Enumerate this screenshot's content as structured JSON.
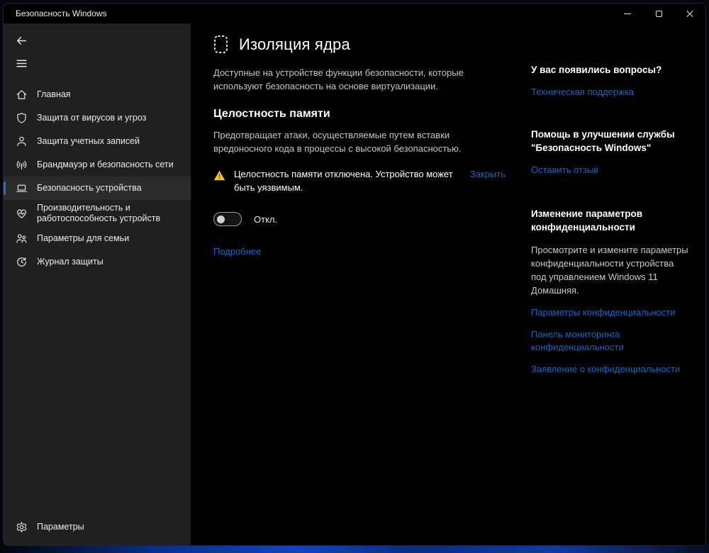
{
  "window": {
    "title": "Безопасность Windows"
  },
  "sidebar": {
    "items": [
      {
        "label": "Главная"
      },
      {
        "label": "Защита от вирусов и угроз"
      },
      {
        "label": "Защита учетных записей"
      },
      {
        "label": "Брандмауэр и безопасность сети"
      },
      {
        "label": "Безопасность устройства",
        "selected": true
      },
      {
        "label": "Производительность и работоспособность устройств"
      },
      {
        "label": "Параметры для семьи"
      },
      {
        "label": "Журнал защиты"
      }
    ],
    "settings_label": "Параметры"
  },
  "main": {
    "title": "Изоляция ядра",
    "description": "Доступные на устройстве функции безопасности, которые используют безопасность на основе виртуализации.",
    "memory_integrity": {
      "heading": "Целостность памяти",
      "description": "Предотвращает атаки, осуществляемые путем вставки вредоносного кода в процессы с высокой безопасностью.",
      "warning_text": "Целостность памяти отключена. Устройство может быть уязвимым.",
      "dismiss_label": "Закрыть",
      "toggle_on": false,
      "toggle_state_label": "Откл.",
      "learn_more_label": "Подробнее"
    }
  },
  "aside": {
    "sections": [
      {
        "heading": "У вас появились вопросы?",
        "links": [
          "Техническая поддержка"
        ]
      },
      {
        "heading": "Помощь в улучшении службы \"Безопасность Windows\"",
        "links": [
          "Оставить отзыв"
        ]
      },
      {
        "heading": "Изменение параметров конфиденциальности",
        "body": "Просмотрите и измените параметры конфиденциальности устройства под управлением Windows 11 Домашняя.",
        "links": [
          "Параметры конфиденциальности",
          "Панель мониторинга конфиденциальности",
          "Заявление о конфиденциальности"
        ]
      }
    ]
  },
  "colors": {
    "link": "#1068c2",
    "accent": "#1d74cf",
    "warning": "#fcc51e",
    "sidebar_bg": "#202020",
    "window_bg": "#010101"
  }
}
